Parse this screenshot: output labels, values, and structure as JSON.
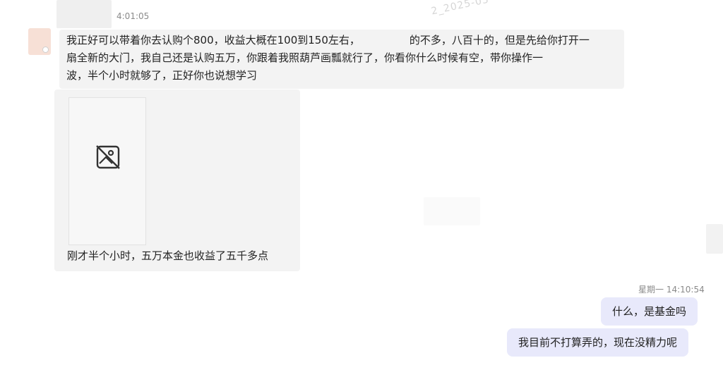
{
  "chat": {
    "incoming": {
      "timestamp": "4:01:05",
      "message1": {
        "line1": "我正好可以带着你去认购个800，收益大概在100到150左右，",
        "line1_tail": "的不多，八百十的，但是先给你打开一",
        "line2": "扇全新的大门，我自己还是认购五万，你跟着我照葫芦画瓢就行了，你看你什么时候有空，带你操作一",
        "line3": "波，半个小时就够了，正好你也说想学习"
      },
      "image_icon": "broken-image-icon",
      "caption": "刚才半个小时，五万本金也收益了五千多点"
    },
    "outgoing": {
      "timestamp": "星期一 14:10:54",
      "message1": "什么，是基金吗",
      "message2": "我目前不打算弄的，现在没精力呢"
    }
  },
  "colors": {
    "incoming_bubble": "#f3f3f3",
    "outgoing_bubble": "#e8e9fb",
    "timestamp_text": "#8a8a8a"
  }
}
